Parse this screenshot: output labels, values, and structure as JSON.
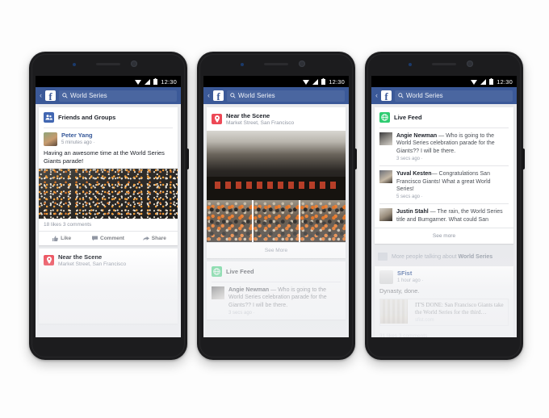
{
  "statusbar": {
    "time": "12:30",
    "icons": [
      "wifi-icon",
      "signal-icon",
      "battery-icon"
    ]
  },
  "appbar": {
    "back_label": "‹",
    "logo_letter": "f",
    "search_query": "World Series",
    "search_placeholder": "Search"
  },
  "colors": {
    "facebook_blue": "#3b5998",
    "search_field": "#4a66a0",
    "friends_icon": "#4267b2",
    "live_feed_icon": "#2ecc71",
    "near_scene_icon": "#ed4956",
    "link_text": "#365899",
    "page_bg": "#e9eaed"
  },
  "phone1": {
    "sections": {
      "friends_and_groups": {
        "title": "Friends and Groups",
        "icon": "friends-icon"
      },
      "near_the_scene": {
        "title": "Near the Scene",
        "subtitle": "Market Street, San Francisco",
        "icon": "location-pin-icon"
      }
    },
    "post": {
      "author": "Peter Yang",
      "meta": "5 minutes ago · ",
      "privacy_icon": "globe-icon",
      "text": "Having an awesome time at the World Series Giants parade!",
      "stats": "18 likes  3 comments",
      "actions": [
        {
          "label": "Like",
          "icon": "thumbs-up-icon"
        },
        {
          "label": "Comment",
          "icon": "comment-icon"
        },
        {
          "label": "Share",
          "icon": "share-icon"
        }
      ]
    }
  },
  "phone2": {
    "sections": {
      "near_the_scene": {
        "title": "Near the Scene",
        "subtitle": "Market Street, San Francisco",
        "icon": "location-pin-icon"
      },
      "live_feed": {
        "title": "Live Feed",
        "icon": "globe-icon"
      }
    },
    "see_more": "See More",
    "live_post": {
      "author": "Angie Newman",
      "dash": " — ",
      "text": "Who is going to the World Series celebration parade for the Giants?? I will be there.",
      "time": "3 secs ago · "
    }
  },
  "phone3": {
    "sections": {
      "live_feed": {
        "title": "Live Feed",
        "icon": "globe-icon"
      }
    },
    "live_posts": [
      {
        "author": "Angie Newman",
        "dash": " — ",
        "text": "Who is going to the World Series celebration parade for the Giants?? I will be there.",
        "time": "3 secs ago · "
      },
      {
        "author": "Yuval Kesten",
        "dash": "— ",
        "text": "Congratulations San Francisco Giants! What a great World Series!",
        "time": "5 secs ago · "
      },
      {
        "author": "Justin Stahl",
        "dash": " — ",
        "text": "The rain, the World Series title and Bumgarner. What could San",
        "time": ""
      }
    ],
    "see_more": "See more",
    "more_people": {
      "prefix": "More people talking about ",
      "highlight": "World Series",
      "icon": "more-photos-icon"
    },
    "page_post": {
      "page_name": "SFist",
      "meta": "1 hour ago · ",
      "text": "Dynasty, done.",
      "attachment": {
        "title": "IT'S DONE: San Francisco Giants take the World Series for the third…",
        "domain": "sfist.com"
      },
      "stats": "31 likes  3 comments"
    }
  }
}
